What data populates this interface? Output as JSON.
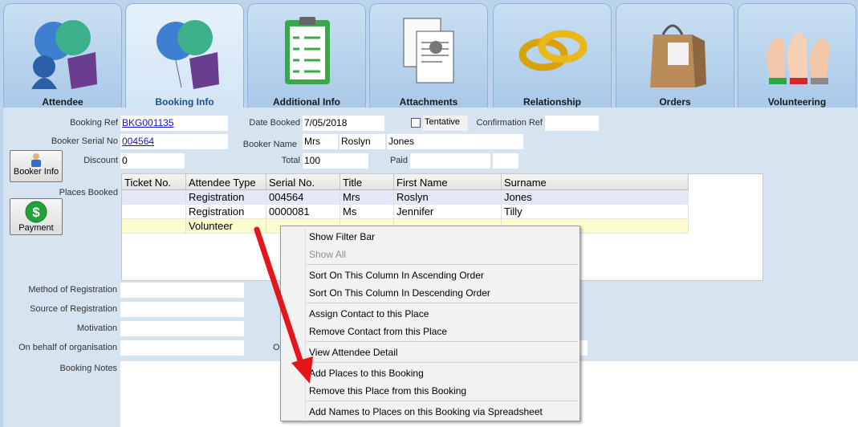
{
  "tabs": [
    {
      "label": "Attendee",
      "icon": "attendee-balloons-icon"
    },
    {
      "label": "Booking Info",
      "icon": "booking-balloons-icon",
      "active": true
    },
    {
      "label": "Additional Info",
      "icon": "clipboard-checklist-icon"
    },
    {
      "label": "Attachments",
      "icon": "documents-pin-icon"
    },
    {
      "label": "Relationship",
      "icon": "gold-rings-icon"
    },
    {
      "label": "Orders",
      "icon": "shopping-bag-icon"
    },
    {
      "label": "Volunteering",
      "icon": "raised-hands-icon"
    }
  ],
  "form": {
    "booking_ref_label": "Booking Ref",
    "booking_ref": "BKG001135",
    "date_booked_label": "Date Booked",
    "date_booked": "7/05/2018",
    "tentative_label": "Tentative",
    "confirmation_ref_label": "Confirmation Ref",
    "confirmation_ref": "",
    "booker_serial_label": "Booker Serial No",
    "booker_serial": "004564",
    "booker_name_label": "Booker Name",
    "booker_title": "Mrs",
    "booker_first": "Roslyn",
    "booker_last": "Jones",
    "discount_label": "Discount",
    "discount": "0",
    "total_label": "Total",
    "total": "100",
    "paid_label": "Paid",
    "paid": "",
    "places_booked_label": "Places Booked",
    "method_label": "Method of Registration",
    "source_label": "Source of Registration",
    "motivation_label": "Motivation",
    "behalf_label": "On behalf of organisation",
    "notes_label": "Booking Notes",
    "o_label": "O"
  },
  "buttons": {
    "booker_info": "Booker Info",
    "payment": "Payment"
  },
  "grid": {
    "columns": [
      "Ticket No.",
      "Attendee Type",
      "Serial No.",
      "Title",
      "First Name",
      "Surname"
    ],
    "rows": [
      [
        "",
        "Registration",
        "004564",
        "Mrs",
        "Roslyn",
        "Jones"
      ],
      [
        "",
        "Registration",
        "0000081",
        "Ms",
        "Jennifer",
        "Tilly"
      ],
      [
        "",
        "Volunteer",
        "",
        "",
        "",
        ""
      ]
    ]
  },
  "menu": {
    "show_filter_bar": "Show Filter Bar",
    "show_all": "Show All",
    "sort_asc": "Sort On This Column In Ascending Order",
    "sort_desc": "Sort On This Column In Descending Order",
    "assign_contact": "Assign Contact to this Place",
    "remove_contact": "Remove Contact from this Place",
    "view_attendee": "View Attendee Detail",
    "add_places": "Add Places to this Booking",
    "remove_place": "Remove this Place from this Booking",
    "add_names": "Add Names to Places on this Booking via Spreadsheet"
  },
  "colors": {
    "background": "#b9d4ec",
    "panel": "#d6e4f2",
    "selected_row": "#e4e8f8",
    "new_row": "#fdfbd0",
    "link": "#1515d0",
    "arrow": "#e3161b"
  }
}
